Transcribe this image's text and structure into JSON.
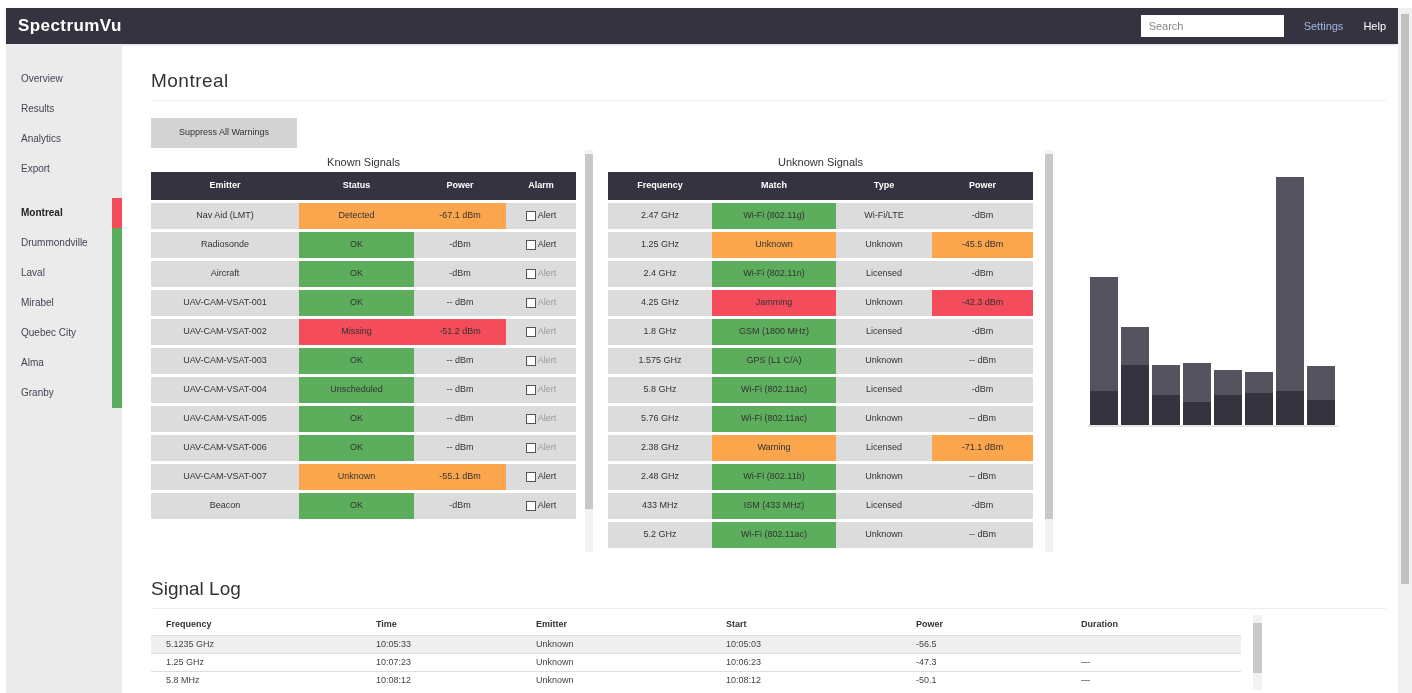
{
  "app": {
    "brand": "SpectrumVu",
    "search": {
      "placeholder": "Search"
    },
    "links": [
      "Settings",
      "Help"
    ]
  },
  "sidebar": {
    "nav": [
      "Overview",
      "Results",
      "Analytics",
      "Export"
    ],
    "sites": [
      {
        "label": "Montreal",
        "color": "#f44c5a",
        "selected": true
      },
      {
        "label": "Drummondville",
        "color": "#5cad5c",
        "selected": false
      },
      {
        "label": "Laval",
        "color": "#5cad5c",
        "selected": false
      },
      {
        "label": "Mirabel",
        "color": "#5cad5c",
        "selected": false
      },
      {
        "label": "Quebec City",
        "color": "#5cad5c",
        "selected": false
      },
      {
        "label": "Alma",
        "color": "#5cad5c",
        "selected": false
      },
      {
        "label": "Granby",
        "color": "#5cad5c",
        "selected": false
      }
    ]
  },
  "page": {
    "title": "Montreal",
    "button": "Suppress All Warnings"
  },
  "known": {
    "title": "Known Signals",
    "columns": [
      "Emitter",
      "Status",
      "Power",
      "Alarm"
    ],
    "rows": [
      {
        "emitter": "Nav Aid (LMT)",
        "status": {
          "text": "Detected",
          "color": "#fba64c"
        },
        "power": {
          "text": "-67.1 dBm",
          "color": "#fba64c"
        },
        "alarm": "Alert",
        "checked": false,
        "disabled": false
      },
      {
        "emitter": "Radiosonde",
        "status": {
          "text": "OK",
          "color": "#5cad5c"
        },
        "power": {
          "text": "-dBm"
        },
        "alarm": "Alert",
        "checked": false,
        "disabled": false
      },
      {
        "emitter": "Aircraft",
        "status": {
          "text": "OK",
          "color": "#5cad5c"
        },
        "power": {
          "text": "-dBm"
        },
        "alarm": "Alert",
        "checked": false,
        "disabled": true
      },
      {
        "emitter": "UAV-CAM-VSAT-001",
        "status": {
          "text": "OK",
          "color": "#5cad5c"
        },
        "power": {
          "text": "-- dBm"
        },
        "alarm": "Alert",
        "checked": false,
        "disabled": true
      },
      {
        "emitter": "UAV-CAM-VSAT-002",
        "status": {
          "text": "Missing",
          "color": "#f44c5a"
        },
        "power": {
          "text": "-51.2 dBm",
          "color": "#f44c5a"
        },
        "alarm": "Alert",
        "checked": false,
        "disabled": true
      },
      {
        "emitter": "UAV-CAM-VSAT-003",
        "status": {
          "text": "OK",
          "color": "#5cad5c"
        },
        "power": {
          "text": "-- dBm"
        },
        "alarm": "Alert",
        "checked": false,
        "disabled": true
      },
      {
        "emitter": "UAV-CAM-VSAT-004",
        "status": {
          "text": "Unscheduled",
          "color": "#5cad5c"
        },
        "power": {
          "text": "-- dBm"
        },
        "alarm": "Alert",
        "checked": false,
        "disabled": true
      },
      {
        "emitter": "UAV-CAM-VSAT-005",
        "status": {
          "text": "OK",
          "color": "#5cad5c"
        },
        "power": {
          "text": "-- dBm"
        },
        "alarm": "Alert",
        "checked": false,
        "disabled": true
      },
      {
        "emitter": "UAV-CAM-VSAT-006",
        "status": {
          "text": "OK",
          "color": "#5cad5c"
        },
        "power": {
          "text": "-- dBm"
        },
        "alarm": "Alert",
        "checked": false,
        "disabled": true
      },
      {
        "emitter": "UAV-CAM-VSAT-007",
        "status": {
          "text": "Unknown",
          "color": "#fba64c"
        },
        "power": {
          "text": "-55.1 dBm",
          "color": "#fba64c"
        },
        "alarm": "Alert",
        "checked": false,
        "disabled": false
      },
      {
        "emitter": "Beacon",
        "status": {
          "text": "OK",
          "color": "#5cad5c"
        },
        "power": {
          "text": "-dBm"
        },
        "alarm": "Alert",
        "checked": false,
        "disabled": false
      }
    ]
  },
  "unknown": {
    "title": "Unknown Signals",
    "columns": [
      "Frequency",
      "Match",
      "Type",
      "Power"
    ],
    "rows": [
      {
        "frequency": "2.47 GHz",
        "match": {
          "text": "Wi-Fi (802.11g)",
          "color": "#5cad5c"
        },
        "type": "Wi-Fi/LTE",
        "power": {
          "text": "-dBm"
        }
      },
      {
        "frequency": "1.25 GHz",
        "match": {
          "text": "Unknown",
          "color": "#fba64c"
        },
        "type": "Unknown",
        "power": {
          "text": "-45.5 dBm",
          "color": "#fba64c"
        }
      },
      {
        "frequency": "2.4 GHz",
        "match": {
          "text": "Wi-Fi (802.11n)",
          "color": "#5cad5c"
        },
        "type": "Licensed",
        "power": {
          "text": "-dBm"
        }
      },
      {
        "frequency": "4.25 GHz",
        "match": {
          "text": "Jamming",
          "color": "#f44c5a"
        },
        "type": "Unknown",
        "power": {
          "text": "-42.3 dBm",
          "color": "#f44c5a"
        }
      },
      {
        "frequency": "1.8 GHz",
        "match": {
          "text": "GSM (1800 MHz)",
          "color": "#5cad5c"
        },
        "type": "Licensed",
        "power": {
          "text": "-dBm"
        }
      },
      {
        "frequency": "1.575 GHz",
        "match": {
          "text": "GPS (L1 C/A)",
          "color": "#5cad5c"
        },
        "type": "Unknown",
        "power": {
          "text": "-- dBm"
        }
      },
      {
        "frequency": "5.8 GHz",
        "match": {
          "text": "Wi-Fi (802.11ac)",
          "color": "#5cad5c"
        },
        "type": "Licensed",
        "power": {
          "text": "-dBm"
        }
      },
      {
        "frequency": "5.76 GHz",
        "match": {
          "text": "Wi-Fi (802.11ac)",
          "color": "#5cad5c"
        },
        "type": "Unknown",
        "power": {
          "text": "-- dBm"
        }
      },
      {
        "frequency": "2.38 GHz",
        "match": {
          "text": "Warning",
          "color": "#fba64c"
        },
        "type": "Licensed",
        "power": {
          "text": "-71.1 dBm",
          "color": "#fba64c"
        }
      },
      {
        "frequency": "2.48 GHz",
        "match": {
          "text": "Wi-Fi (802.11b)",
          "color": "#5cad5c"
        },
        "type": "Unknown",
        "power": {
          "text": "-- dBm"
        }
      },
      {
        "frequency": "433 MHz",
        "match": {
          "text": "ISM (433 MHz)",
          "color": "#5cad5c"
        },
        "type": "Licensed",
        "power": {
          "text": "-dBm"
        }
      },
      {
        "frequency": "5.2 GHz",
        "match": {
          "text": "Wi-Fi (802.11ac)",
          "color": "#5cad5c"
        },
        "type": "Unknown",
        "power": {
          "text": "-- dBm"
        }
      }
    ]
  },
  "log": {
    "title": "Signal Log",
    "columns": [
      "Frequency",
      "Time",
      "Emitter",
      "Start",
      "Power",
      "Duration"
    ],
    "rows": [
      {
        "cells": [
          "5.1235 GHz",
          "10:05:33",
          "Unknown",
          "10:05:03",
          "-56.5"
        ],
        "selected": true
      },
      {
        "cells": [
          "1.25 GHz",
          "10:07:23",
          "Unknown",
          "10:06:23",
          "-47.3",
          "—"
        ],
        "selected": false
      },
      {
        "cells": [
          "5.8 MHz",
          "10:08:12",
          "Unknown",
          "10:08:12",
          "-50.1",
          "—"
        ],
        "selected": false
      }
    ]
  }
}
